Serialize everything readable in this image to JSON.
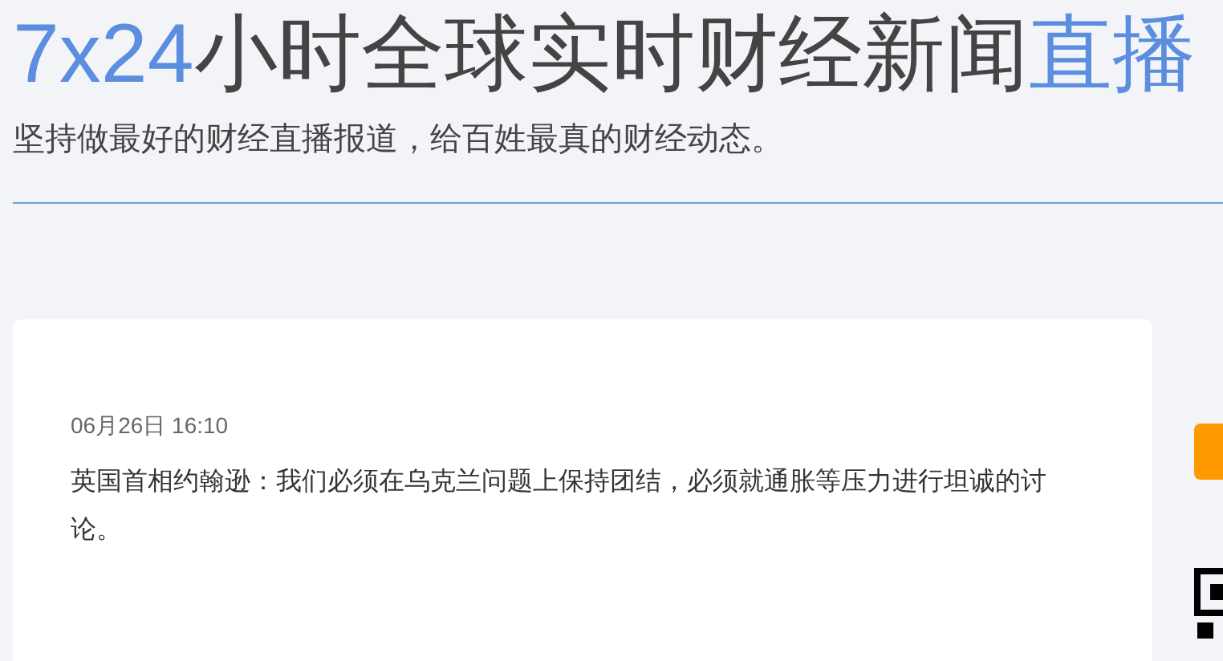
{
  "header": {
    "title_parts": [
      {
        "text": "7x24",
        "highlight": true
      },
      {
        "text": "小时全球实时财经新闻",
        "highlight": false
      },
      {
        "text": "直播",
        "highlight": true
      }
    ],
    "subtitle": "坚持做最好的财经直播报道，给百姓最真的财经动态。"
  },
  "news": [
    {
      "time": "06月26日 16:10",
      "text": "英国首相约翰逊：我们必须在乌克兰问题上保持团结，必须就通胀等压力进行坦诚的讨论。"
    }
  ]
}
